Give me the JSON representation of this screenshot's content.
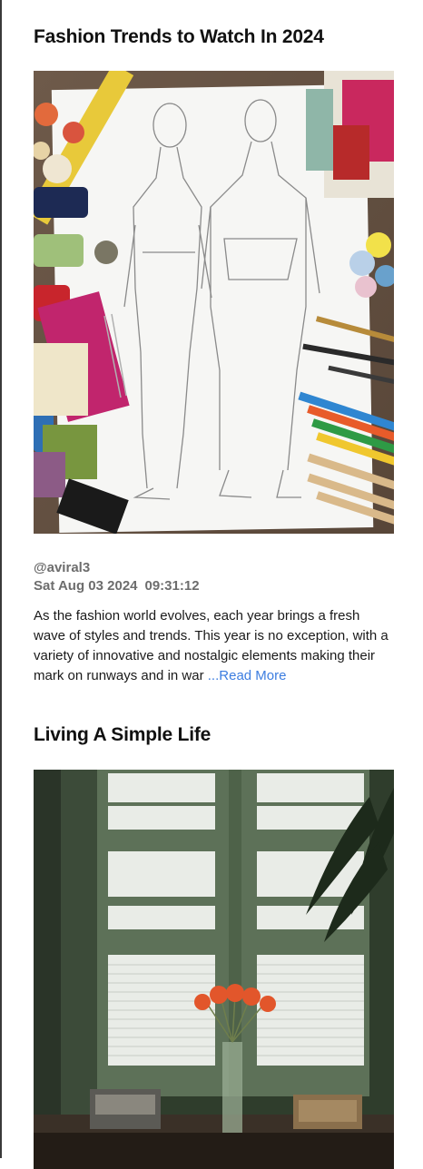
{
  "posts": [
    {
      "title": "Fashion Trends to Watch In 2024",
      "image_alt": "Fashion sketch with sewing supplies",
      "author": "@aviral3",
      "date": "Sat Aug 03 2024",
      "time": "09:31:12",
      "excerpt": "As the fashion world evolves, each year brings a fresh wave of styles and trends. This year is no exception, with a variety of innovative and nostalgic elements making their mark on runways and in war",
      "read_more": " ...Read More"
    },
    {
      "title": "Living A Simple Life",
      "image_alt": "Window with orange flowers in a vase"
    }
  ],
  "colors": {
    "accent_link": "#3c7de0",
    "meta_text": "#6d6d6d"
  }
}
